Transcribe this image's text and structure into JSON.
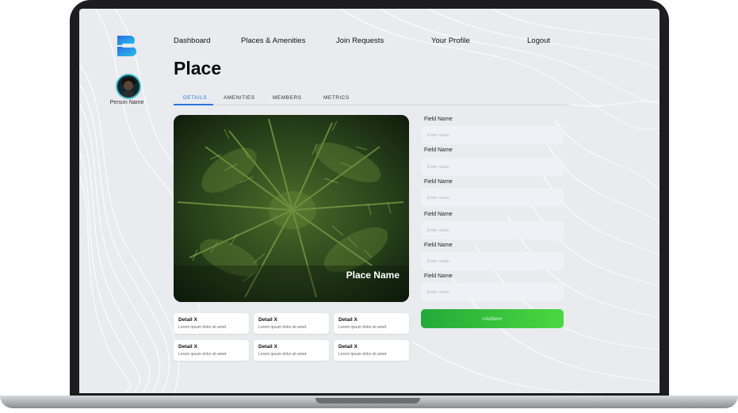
{
  "nav": {
    "items": [
      "Dashboard",
      "Places & Amenities",
      "Join Requests",
      "Your Profile",
      "Logout"
    ]
  },
  "sidebar": {
    "person_name": "Person Name"
  },
  "page": {
    "title": "Place"
  },
  "tabs": [
    "DETAILS",
    "AMENITIES",
    "MEMBERS",
    "METRICS"
  ],
  "active_tab": "DETAILS",
  "hero": {
    "place_name": "Place Name"
  },
  "details": [
    {
      "title": "Detail X",
      "subtitle": "Lorem ipsum dolor sit amet"
    },
    {
      "title": "Detail X",
      "subtitle": "Lorem ipsum dolor sit amet"
    },
    {
      "title": "Detail X",
      "subtitle": "Lorem ipsum dolor sit amet"
    },
    {
      "title": "Detail X",
      "subtitle": "Lorem ipsum dolor sit amet"
    },
    {
      "title": "Detail X",
      "subtitle": "Lorem ipsum dolor sit amet"
    },
    {
      "title": "Detail X",
      "subtitle": "Lorem ipsum dolor sit amet"
    }
  ],
  "form": {
    "fields": [
      {
        "label": "Field Name",
        "placeholder": "Enter value"
      },
      {
        "label": "Field Name",
        "placeholder": "Enter value"
      },
      {
        "label": "Field Name",
        "placeholder": "Enter value"
      },
      {
        "label": "Field Name",
        "placeholder": "Enter value"
      },
      {
        "label": "Field Name",
        "placeholder": "Enter value"
      },
      {
        "label": "Field Name",
        "placeholder": "Enter value"
      }
    ],
    "action_label": "<Action>"
  },
  "colors": {
    "accent": "#2d74e0",
    "action": "#3cc23d",
    "logo_gradient": [
      "#2b6ce6",
      "#28c3e6"
    ]
  }
}
